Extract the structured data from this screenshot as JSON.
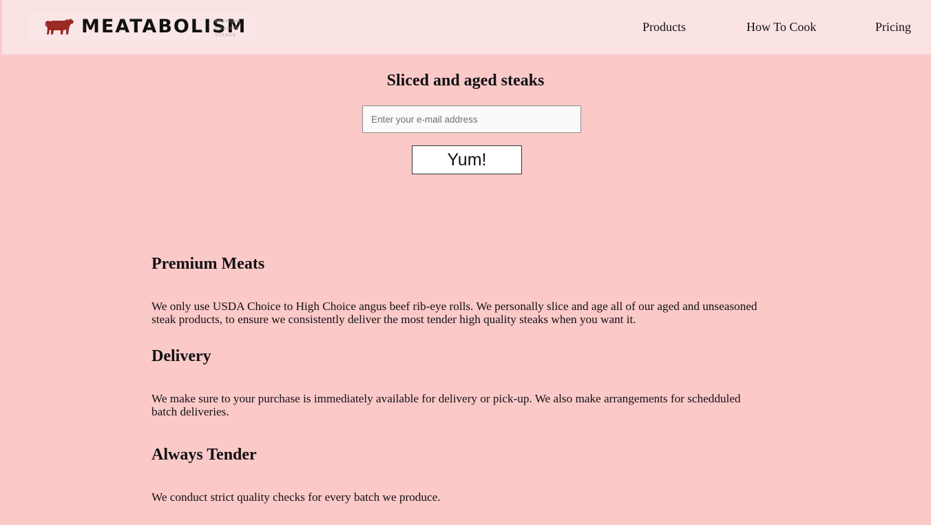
{
  "header": {
    "logo": {
      "wordmark": "MEATABOLISM",
      "tagline": [
        "PREMIUM",
        "QUALITY",
        "STEAKS"
      ],
      "icon": "cow-silhouette-icon",
      "icon_color": "#9a2a24"
    },
    "nav": [
      "Products",
      "How To Cook",
      "Pricing"
    ]
  },
  "hero": {
    "title": "Sliced and aged steaks",
    "email_placeholder": "Enter your e-mail address",
    "email_value": "",
    "submit_label": "Yum!"
  },
  "features": [
    {
      "title": "Premium Meats",
      "text": "We only use USDA Choice to High Choice angus beef rib-eye rolls. We personally slice and age all of our aged and unseasoned steak products, to ensure we consistently deliver the most tender high quality steaks when you want it."
    },
    {
      "title": "Delivery",
      "text": "We make sure to your purchase is immediately available for delivery or pick-up. We also make arrangements for schedduled batch deliveries."
    },
    {
      "title": "Always Tender",
      "text": "We conduct strict quality checks for every batch we produce."
    }
  ],
  "colors": {
    "page_background": "#fcc9c9",
    "header_background": "#fbe3e4",
    "brand_red": "#9a2a24"
  }
}
